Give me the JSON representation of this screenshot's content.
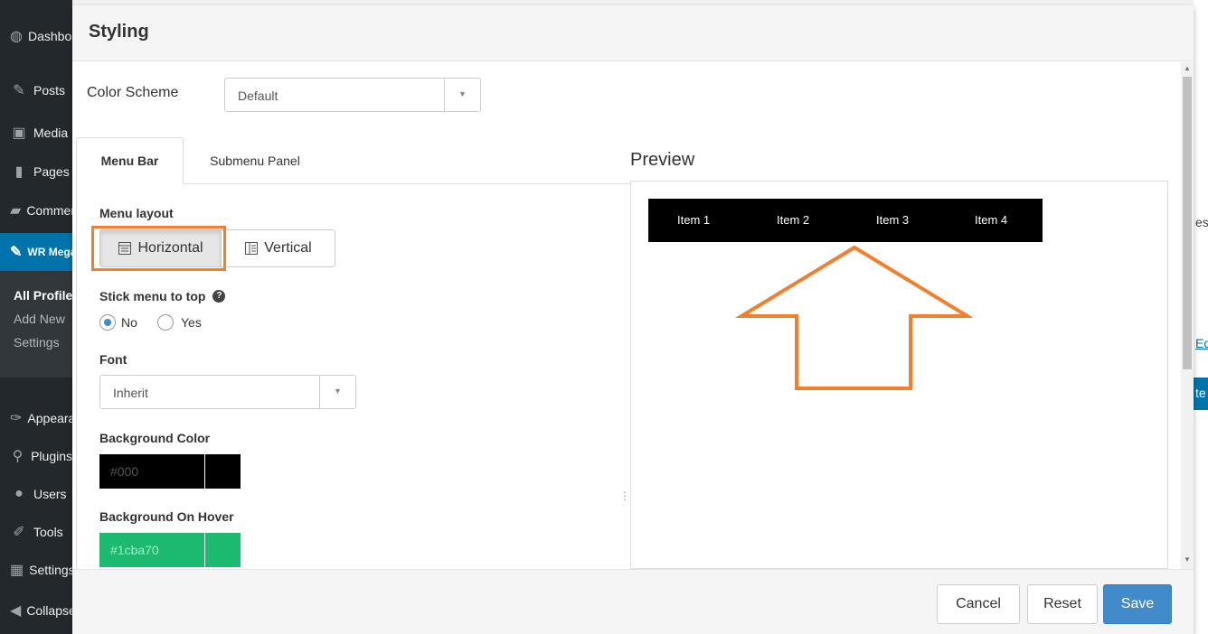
{
  "sidebar": {
    "items": [
      {
        "label": "Dashboard",
        "icon": "dashboard-icon",
        "glyph": "◍"
      },
      {
        "label": "Posts",
        "icon": "pin-icon",
        "glyph": "✎"
      },
      {
        "label": "Media",
        "icon": "media-icon",
        "glyph": "▣"
      },
      {
        "label": "Pages",
        "icon": "page-icon",
        "glyph": "▮"
      },
      {
        "label": "Comments",
        "icon": "comment-icon",
        "glyph": "▰"
      },
      {
        "label": "WR Mega Menu",
        "icon": "pin-icon",
        "glyph": "✎"
      },
      {
        "label": "Appearance",
        "icon": "brush-icon",
        "glyph": "✑"
      },
      {
        "label": "Plugins",
        "icon": "plugin-icon",
        "glyph": "⚲"
      },
      {
        "label": "Users",
        "icon": "user-icon",
        "glyph": "●"
      },
      {
        "label": "Tools",
        "icon": "wrench-icon",
        "glyph": "✐"
      },
      {
        "label": "Settings",
        "icon": "settings-icon",
        "glyph": "▦"
      },
      {
        "label": "Collapse menu",
        "icon": "collapse-icon",
        "glyph": "◀"
      }
    ],
    "submenu": [
      "All Profiles",
      "Add New",
      "Settings"
    ]
  },
  "background_fragments": [
    "es",
    "Ed",
    "te"
  ],
  "modal": {
    "title": "Styling",
    "color_scheme": {
      "label": "Color Scheme",
      "value": "Default"
    },
    "tabs": [
      "Menu Bar",
      "Submenu Panel"
    ],
    "menu_layout": {
      "label": "Menu layout",
      "options": [
        {
          "label": "Horizontal",
          "icon": "horizontal-layout-icon",
          "selected": true
        },
        {
          "label": "Vertical",
          "icon": "vertical-layout-icon",
          "selected": false
        }
      ]
    },
    "stick_menu": {
      "label": "Stick menu to top",
      "options": [
        {
          "label": "No",
          "selected": true
        },
        {
          "label": "Yes",
          "selected": false
        }
      ]
    },
    "font": {
      "label": "Font",
      "value": "Inherit"
    },
    "background_color": {
      "label": "Background Color",
      "value": "#000"
    },
    "background_hover": {
      "label": "Background On Hover",
      "value": "#1cba70"
    },
    "preview": {
      "title": "Preview",
      "items": [
        "Item 1",
        "Item 2",
        "Item 3",
        "Item 4"
      ]
    },
    "footer": {
      "cancel": "Cancel",
      "reset": "Reset",
      "save": "Save"
    }
  },
  "colors": {
    "highlight_orange": "#f37f2c",
    "primary_blue": "#428bca",
    "wp_sidebar": "#23282d",
    "wp_active": "#0073aa"
  }
}
